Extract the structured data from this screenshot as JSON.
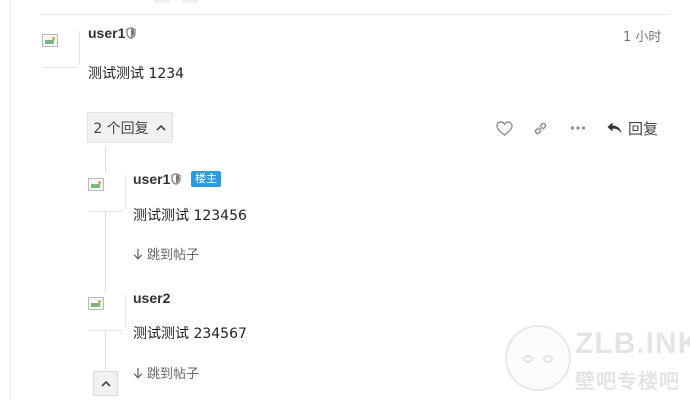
{
  "main_post": {
    "username": "user1",
    "timestamp": "1 小时",
    "content": "测试测试 1234"
  },
  "controls": {
    "replies_toggle_label": "2 个回复",
    "reply_label": "回复"
  },
  "replies": [
    {
      "username": "user1",
      "badge": "楼主",
      "content": "测试测试 123456",
      "jump_label": "跳到帖子"
    },
    {
      "username": "user2",
      "content": "测试测试 234567",
      "jump_label": "跳到帖子"
    }
  ],
  "watermark": {
    "logo_text": "ZLB.INK",
    "sub_text": "壁吧专楼吧"
  },
  "icons": {
    "moderator": "shield-icon",
    "like": "heart-icon",
    "link": "link-icon",
    "more": "ellipsis-icon",
    "reply": "reply-arrow-icon",
    "expand": "chevron-up-icon",
    "jump": "arrow-down-icon"
  },
  "colors": {
    "op_badge": "#2e9bdc",
    "button_bg": "#f1f1f1",
    "muted_text": "#777777"
  }
}
